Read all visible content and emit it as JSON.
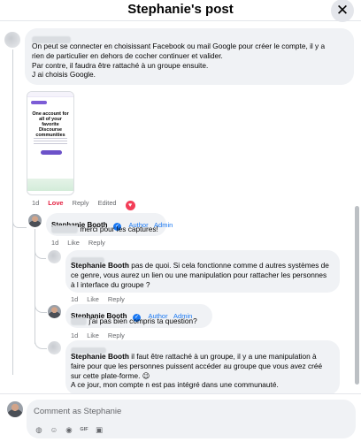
{
  "header": {
    "title": "Stephanie's post",
    "close_icon": "close-icon"
  },
  "first_comment": {
    "lines": [
      "On peut se connecter en choisissant Facebook ou mail Google pour créer le compte, il y a",
      "rien de particulier en dehors de cocher continuer et valider.",
      "Par contre, il faudra être rattaché à un groupe ensuite.",
      "J ai choisis Google."
    ],
    "image_headline": "One account for all of your favorite Discourse communities",
    "actions": {
      "time": "1d",
      "love": "Love",
      "reply": "Reply",
      "edited": "Edited"
    }
  },
  "reply1": {
    "name": "Stephanie Booth",
    "badges": [
      "Author",
      "Admin"
    ],
    "text": "merci pour les captures!",
    "actions": {
      "time": "1d",
      "like": "Like",
      "reply": "Reply"
    }
  },
  "reply2": {
    "name": "Stephanie Booth",
    "text_lines": [
      "pas de quoi. Si cela fonctionne comme d autres systèmes de",
      "ce genre, vous aurez un lien ou une manipulation pour rattacher les personnes",
      "à l interface du groupe ?"
    ],
    "actions": {
      "time": "1d",
      "like": "Like",
      "reply": "Reply"
    }
  },
  "reply3": {
    "name": "Stephanie Booth",
    "badges": [
      "Author",
      "Admin"
    ],
    "text": "j'ai pas bien compris ta question?",
    "actions": {
      "time": "1d",
      "like": "Like",
      "reply": "Reply"
    }
  },
  "reply4": {
    "name": "Stephanie Booth",
    "text_lines": [
      "il faut être rattaché à un groupe, il y a une manipulation à",
      "faire pour que les personnes puissent accéder au groupe que vous avez créé",
      "sur cette plate-forme. 😉",
      "A ce jour, mon compte n est pas intégré dans une communauté."
    ]
  },
  "composer": {
    "placeholder": "Comment as Stephanie",
    "tool_icons": [
      "sticker-icon",
      "emoji-icon",
      "camera-icon",
      "gif-icon",
      "stamp-icon"
    ]
  },
  "colors": {
    "accent": "#1877f2",
    "love": "#e41e3f",
    "bubble": "#f0f2f5"
  }
}
